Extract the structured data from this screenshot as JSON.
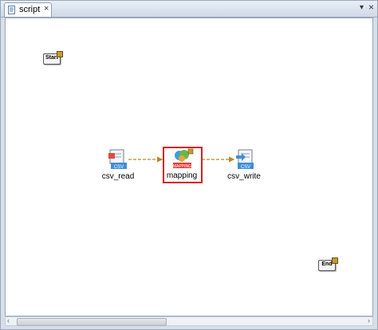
{
  "tab": {
    "title": "script",
    "close_glyph": "×"
  },
  "window": {
    "dropdown_glyph": "▾",
    "close_glyph": "×"
  },
  "nodes": {
    "start": {
      "label": "Start"
    },
    "end": {
      "label": "End"
    },
    "csv_read": {
      "name": "csv_read",
      "badge": "CSV"
    },
    "mapping": {
      "name": "mapping",
      "badge": "MAPPING"
    },
    "csv_write": {
      "name": "csv_write",
      "badge": "CSV"
    }
  },
  "scrollbar": {
    "left_arrow": "‹",
    "right_arrow": "›"
  },
  "colors": {
    "selection": "#d81e1e",
    "connector": "#b58a2e",
    "badge_blue": "#3e8fd6",
    "badge_red": "#e0403a"
  }
}
